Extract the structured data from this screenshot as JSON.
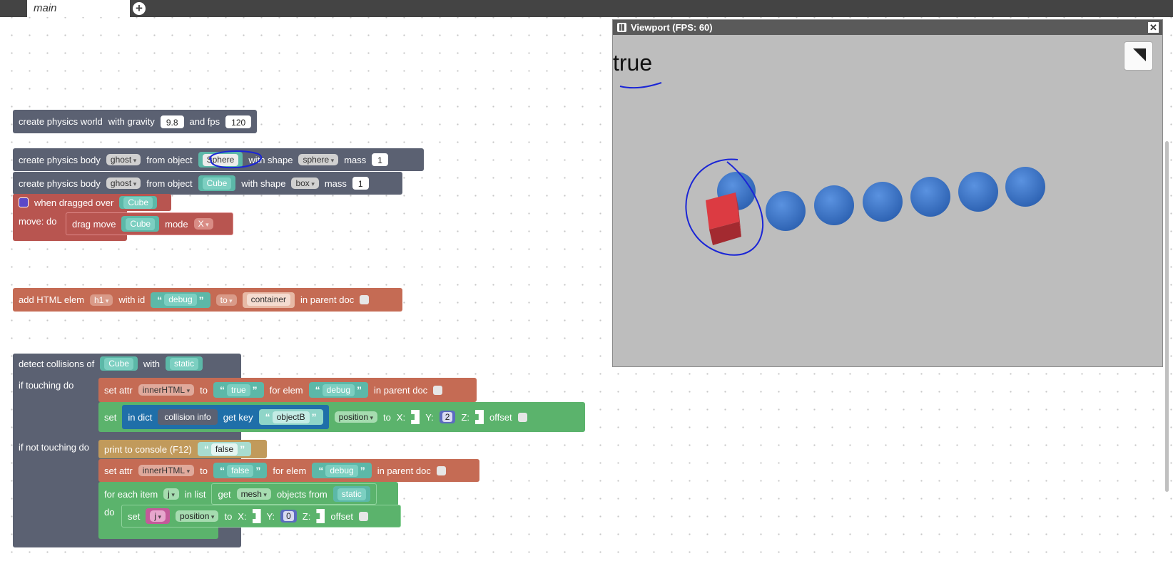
{
  "tabs": {
    "active": "main"
  },
  "viewport": {
    "title": "Viewport (FPS: 60)",
    "debug_text": "true"
  },
  "b1": {
    "create": "create physics world",
    "gravity": "with gravity",
    "gravity_val": "9.8",
    "fps": "and fps",
    "fps_val": "120"
  },
  "b2": {
    "create": "create physics body",
    "type": "ghost",
    "from": "from object",
    "object": "Sphere",
    "shape_lbl": "with shape",
    "shape": "sphere",
    "mass_lbl": "mass",
    "mass": "1"
  },
  "b3": {
    "create": "create physics body",
    "type": "ghost",
    "from": "from object",
    "object": "Cube",
    "shape_lbl": "with shape",
    "shape": "box",
    "mass_lbl": "mass",
    "mass": "1"
  },
  "b4": {
    "when": "when dragged over",
    "object": "Cube",
    "move": "move: do",
    "drag": "drag move",
    "drag_obj": "Cube",
    "mode_lbl": "mode",
    "mode": "X"
  },
  "b5": {
    "add": "add HTML elem",
    "tag": "h1",
    "with_id": "with id",
    "id": "debug",
    "to": "to",
    "container": "container",
    "parent": "in parent doc"
  },
  "b6": {
    "detect": "detect collisions of",
    "obj": "Cube",
    "with": "with",
    "target": "static",
    "if_touching": "if touching do",
    "set_attr": "set attr",
    "attr": "innerHTML",
    "to": "to",
    "true_val": "true",
    "for_elem": "for elem",
    "elem": "debug",
    "parent": "in parent doc",
    "set": "set",
    "in_dict": "in dict",
    "dict": "collision info",
    "get_key": "get key",
    "key": "objectB",
    "prop": "position",
    "to2": "to",
    "x": "X:",
    "y": "Y:",
    "y_val": "2",
    "z": "Z:",
    "offset": "offset",
    "if_not": "if not touching do",
    "print": "print to console (F12)",
    "false_print": "false",
    "set_attr2": "set attr",
    "attr2": "innerHTML",
    "to3": "to",
    "false_val": "false",
    "for_elem2": "for elem",
    "elem2": "debug",
    "parent2": "in parent doc",
    "for_each": "for each item",
    "item": "j",
    "in_list": "in list",
    "get": "get",
    "mesh": "mesh",
    "objects_from": "objects from",
    "source": "static",
    "do": "do",
    "set2": "set",
    "var": "j",
    "prop2": "position",
    "to4": "to",
    "x2": "X:",
    "y2": "Y:",
    "y2_val": "0",
    "z2": "Z:",
    "offset2": "offset"
  },
  "colors": {
    "physics": "#5b6172",
    "event": "#b85550",
    "html": "#c56b54",
    "loop": "#5bb36c",
    "text": "#5cb8a8",
    "viewport_bg": "#bdbdbd",
    "sphere": "#3f78c9",
    "cube": "#d8383f",
    "annotation": "#1a25d6"
  }
}
